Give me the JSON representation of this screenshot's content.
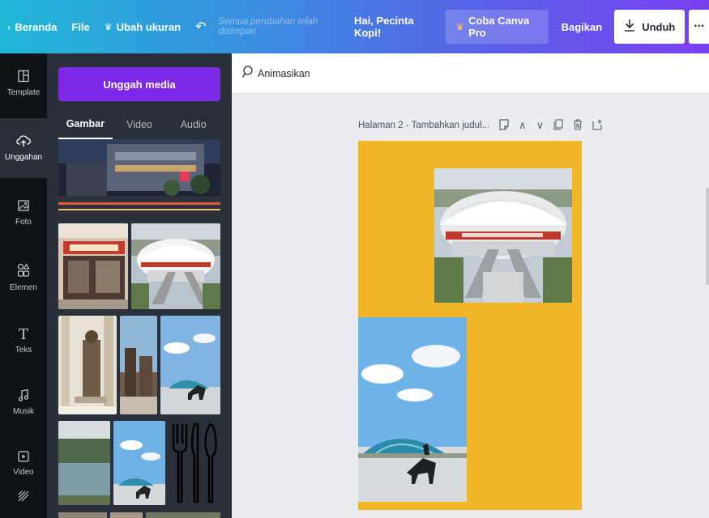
{
  "topbar": {
    "home": "Beranda",
    "file": "File",
    "resize": "Ubah ukuran",
    "saved_status": "Semua perubahan telah disimpan",
    "greeting": "Hai, Pecinta Kopi!",
    "pro": "Coba Canva Pro",
    "share": "Bagikan",
    "download": "Unduh",
    "more": "···"
  },
  "rail": {
    "items": [
      {
        "label": "Template",
        "icon": "template-icon"
      },
      {
        "label": "Unggahan",
        "icon": "upload-cloud-icon"
      },
      {
        "label": "Foto",
        "icon": "photo-icon"
      },
      {
        "label": "Elemen",
        "icon": "shapes-icon"
      },
      {
        "label": "Teks",
        "icon": "text-icon"
      },
      {
        "label": "Musik",
        "icon": "music-icon"
      },
      {
        "label": "Video",
        "icon": "video-icon"
      }
    ]
  },
  "panel": {
    "upload_button": "Unggah media",
    "tabs": [
      "Gambar",
      "Video",
      "Audio"
    ]
  },
  "editor": {
    "animate": "Animasikan",
    "page_title": "Halaman 2 - Tambahkan judul..."
  },
  "colors": {
    "accent_purple": "#7d2ae8",
    "page_yellow": "#f2b728",
    "rail_bg": "#0e1318",
    "panel_bg": "#293039"
  }
}
